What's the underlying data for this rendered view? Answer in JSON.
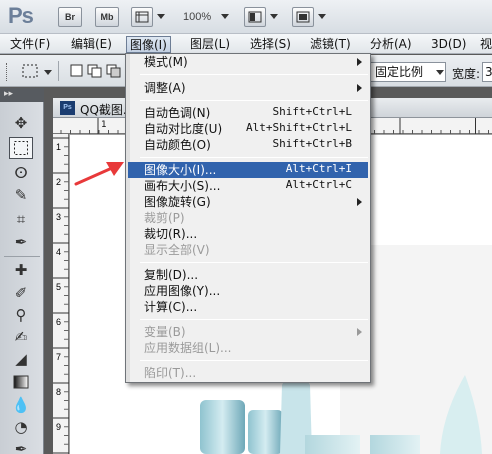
{
  "app": {
    "logo": "Ps",
    "bridge_button": "Br",
    "minibridge_button": "Mb",
    "zoom": "100%"
  },
  "menubar": {
    "items": [
      {
        "label": "文件(F)"
      },
      {
        "label": "编辑(E)"
      },
      {
        "label": "图像(I)"
      },
      {
        "label": "图层(L)"
      },
      {
        "label": "选择(S)"
      },
      {
        "label": "滤镜(T)"
      },
      {
        "label": "分析(A)"
      },
      {
        "label": "3D(D)"
      },
      {
        "label": "视"
      }
    ]
  },
  "options": {
    "style_value": "固定比例",
    "width_label": "宽度:",
    "width_value": "3"
  },
  "document": {
    "tab_icon": "Ps",
    "title": "QQ截图..."
  },
  "image_menu": {
    "items": [
      {
        "label": "模式(M)",
        "shortcut": "",
        "submenu": true,
        "disabled": false
      },
      {
        "label": "调整(A)",
        "shortcut": "",
        "submenu": true,
        "disabled": false
      },
      {
        "label": "自动色调(N)",
        "shortcut": "Shift+Ctrl+L",
        "submenu": false,
        "disabled": false
      },
      {
        "label": "自动对比度(U)",
        "shortcut": "Alt+Shift+Ctrl+L",
        "submenu": false,
        "disabled": false
      },
      {
        "label": "自动颜色(O)",
        "shortcut": "Shift+Ctrl+B",
        "submenu": false,
        "disabled": false
      },
      {
        "label": "图像大小(I)...",
        "shortcut": "Alt+Ctrl+I",
        "submenu": false,
        "disabled": false
      },
      {
        "label": "画布大小(S)...",
        "shortcut": "Alt+Ctrl+C",
        "submenu": false,
        "disabled": false
      },
      {
        "label": "图像旋转(G)",
        "shortcut": "",
        "submenu": true,
        "disabled": false
      },
      {
        "label": "裁剪(P)",
        "shortcut": "",
        "submenu": false,
        "disabled": true
      },
      {
        "label": "裁切(R)...",
        "shortcut": "",
        "submenu": false,
        "disabled": false
      },
      {
        "label": "显示全部(V)",
        "shortcut": "",
        "submenu": false,
        "disabled": true
      },
      {
        "label": "复制(D)...",
        "shortcut": "",
        "submenu": false,
        "disabled": false
      },
      {
        "label": "应用图像(Y)...",
        "shortcut": "",
        "submenu": false,
        "disabled": false
      },
      {
        "label": "计算(C)...",
        "shortcut": "",
        "submenu": false,
        "disabled": false
      },
      {
        "label": "变量(B)",
        "shortcut": "",
        "submenu": true,
        "disabled": true
      },
      {
        "label": "应用数据组(L)...",
        "shortcut": "",
        "submenu": false,
        "disabled": true
      },
      {
        "label": "陷印(T)...",
        "shortcut": "",
        "submenu": false,
        "disabled": true
      }
    ],
    "highlighted": "图像大小(I)..."
  },
  "rulers": {
    "top_ticks": [
      "1",
      "2",
      "3"
    ],
    "left_ticks": [
      "1",
      "2",
      "3",
      "4",
      "5",
      "6",
      "7",
      "8",
      "9",
      "1"
    ]
  },
  "tools": {
    "items": [
      {
        "name": "move-icon"
      },
      {
        "name": "marquee-icon"
      },
      {
        "name": "lasso-icon"
      },
      {
        "name": "quick-select-icon"
      },
      {
        "name": "crop-icon"
      },
      {
        "name": "eyedropper-icon"
      },
      {
        "name": "healing-brush-icon"
      },
      {
        "name": "brush-icon"
      },
      {
        "name": "clone-stamp-icon"
      },
      {
        "name": "history-brush-icon"
      },
      {
        "name": "eraser-icon"
      },
      {
        "name": "gradient-icon"
      },
      {
        "name": "blur-icon"
      },
      {
        "name": "dodge-icon"
      },
      {
        "name": "pen-icon"
      }
    ]
  },
  "colors": {
    "highlight": "#3163ad",
    "arrow": "#e8393a"
  }
}
